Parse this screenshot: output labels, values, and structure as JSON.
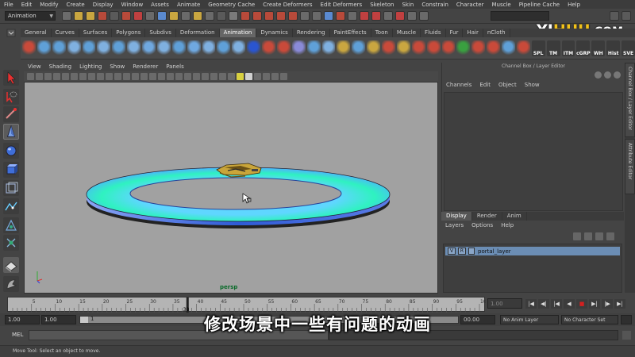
{
  "menu": [
    "File",
    "Edit",
    "Modify",
    "Create",
    "Display",
    "Window",
    "Assets",
    "Animate",
    "Geometry Cache",
    "Create Deformers",
    "Edit Deformers",
    "Skeleton",
    "Skin",
    "Constrain",
    "Character",
    "Muscle",
    "Pipeline Cache",
    "Help"
  ],
  "status": {
    "mode": "Animation"
  },
  "watermark": {
    "part1": "YI",
    "part2": "HUU",
    "part3": ".COM"
  },
  "shelf_tabs": [
    "General",
    "Curves",
    "Surfaces",
    "Polygons",
    "Subdivs",
    "Deformation",
    "Animation",
    "Dynamics",
    "Rendering",
    "PaintEffects",
    "Toon",
    "Muscle",
    "Fluids",
    "Fur",
    "Hair",
    "nCloth"
  ],
  "shelf_active": "Animation",
  "shelf_labels": {
    "spl": "SPL",
    "tm": "TM",
    "itm": "ITM",
    "cgrp": "cGRP",
    "wh": "WH",
    "hist": "Hist",
    "sve": "SVE"
  },
  "viewport_menu": [
    "View",
    "Shading",
    "Lighting",
    "Show",
    "Renderer",
    "Panels"
  ],
  "viewport": {
    "camera": "persp"
  },
  "channel_box": {
    "title": "Channel Box / Layer Editor",
    "menu": [
      "Channels",
      "Edit",
      "Object",
      "Show"
    ]
  },
  "layer_editor": {
    "tabs": [
      "Display",
      "Render",
      "Anim"
    ],
    "active_tab": "Display",
    "menu": [
      "Layers",
      "Options",
      "Help"
    ],
    "layer": {
      "v": "V",
      "r": "R",
      "name": "portal_layer"
    }
  },
  "side_tabs": [
    "Channel Box / Layer Editor",
    "Attribute Editor"
  ],
  "timeline": {
    "ticks": [
      "5",
      "10",
      "15",
      "20",
      "25",
      "30",
      "35",
      "40",
      "45",
      "50",
      "55",
      "60",
      "65",
      "70",
      "75",
      "80",
      "85",
      "90",
      "95",
      "100"
    ],
    "current_frame": "38",
    "current_field": "1.00"
  },
  "range": {
    "start": "1.00",
    "start_playback": "1.00",
    "range_label": "1",
    "end_playback": "00.00",
    "anim_layer": "No Anim Layer",
    "character": "No Character Set"
  },
  "command": {
    "label": "MEL"
  },
  "help": "Move Tool: Select an object to move.",
  "subtitle": "修改场景中一些有问题的动画",
  "colors": {
    "ring_top": "#2ff2c0",
    "ring_side": "#3a62d8",
    "viewport_bg": "#a1a1a1",
    "active_layer": "#6b8db4"
  }
}
